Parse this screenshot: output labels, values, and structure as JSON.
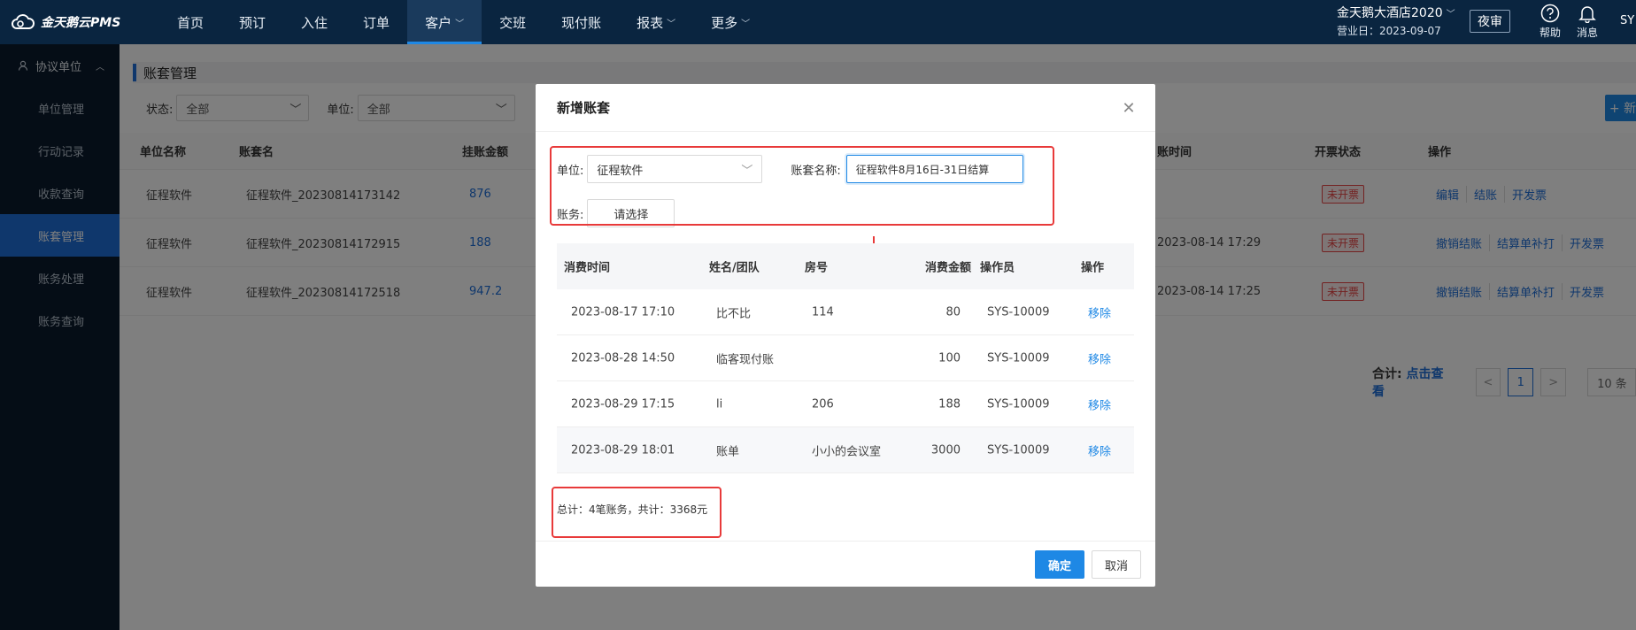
{
  "app": {
    "logo_text": "金天鹅云PMS"
  },
  "nav": {
    "items": [
      {
        "label": "首页"
      },
      {
        "label": "预订"
      },
      {
        "label": "入住"
      },
      {
        "label": "订单"
      },
      {
        "label": "客户"
      },
      {
        "label": "交班"
      },
      {
        "label": "现付账"
      },
      {
        "label": "报表"
      },
      {
        "label": "更多"
      }
    ]
  },
  "header": {
    "hotel_name": "金天鹅大酒店2020",
    "business_date": "营业日：2023-09-07",
    "night_audit": "夜审",
    "help": "帮助",
    "messages": "消息",
    "user": "SY"
  },
  "sidebar": {
    "group": "协议单位",
    "items": [
      {
        "label": "单位管理"
      },
      {
        "label": "行动记录"
      },
      {
        "label": "收款查询"
      },
      {
        "label": "账套管理"
      },
      {
        "label": "账务处理"
      },
      {
        "label": "账务查询"
      }
    ]
  },
  "main": {
    "title": "账套管理",
    "filters": {
      "status_label": "状态:",
      "status_value": "全部",
      "unit_label": "单位:",
      "unit_value": "全部"
    },
    "add_label": "+ 新",
    "table": {
      "headers": {
        "unit": "单位名称",
        "name": "账套名",
        "amount": "挂账金额",
        "time": "账时间",
        "invoice": "开票状态",
        "ops": "操作"
      },
      "rows": [
        {
          "unit": "征程软件",
          "name": "征程软件_20230814173142",
          "amount": "876",
          "time": "",
          "invoice": "未开票",
          "ops": [
            "编辑",
            "结账",
            "开发票"
          ]
        },
        {
          "unit": "征程软件",
          "name": "征程软件_20230814172915",
          "amount": "188",
          "time": "2023-08-14 17:29",
          "invoice": "未开票",
          "ops": [
            "撤销结账",
            "结算单补打",
            "开发票"
          ]
        },
        {
          "unit": "征程软件",
          "name": "征程软件_20230814172518",
          "amount": "947.2",
          "time": "2023-08-14 17:25",
          "invoice": "未开票",
          "ops": [
            "撤销结账",
            "结算单补打",
            "开发票"
          ]
        }
      ]
    },
    "pager": {
      "total_label": "合计:",
      "total_link": "点击查看",
      "prev": "<",
      "current": "1",
      "next": ">",
      "size": "10 条"
    }
  },
  "modal": {
    "title": "新增账套",
    "unit_label": "单位:",
    "unit_value": "征程软件",
    "name_label": "账套名称:",
    "name_value": "征程软件8月16日-31日结算",
    "bill_label": "账务:",
    "bill_placeholder": "请选择",
    "table": {
      "headers": {
        "time": "消费时间",
        "guest": "姓名/团队",
        "room": "房号",
        "amount": "消费金额",
        "operator": "操作员",
        "op": "操作"
      },
      "rows": [
        {
          "time": "2023-08-17 17:10",
          "guest": "比不比",
          "room": "114",
          "amount": "80",
          "operator": "SYS-10009",
          "op": "移除"
        },
        {
          "time": "2023-08-28 14:50",
          "guest": "临客现付账",
          "room": "",
          "amount": "100",
          "operator": "SYS-10009",
          "op": "移除"
        },
        {
          "time": "2023-08-29 17:15",
          "guest": "li",
          "room": "206",
          "amount": "188",
          "operator": "SYS-10009",
          "op": "移除"
        },
        {
          "time": "2023-08-29 18:01",
          "guest": "账单",
          "room": "小小的会议室",
          "amount": "3000",
          "operator": "SYS-10009",
          "op": "移除"
        }
      ]
    },
    "summary": "总计：4笔账务，共计：3368元",
    "ok": "确定",
    "cancel": "取消"
  },
  "colors": {
    "primary": "#1e88e5",
    "nav_bg": "#0a2540",
    "annotation": "#e83a3a"
  }
}
